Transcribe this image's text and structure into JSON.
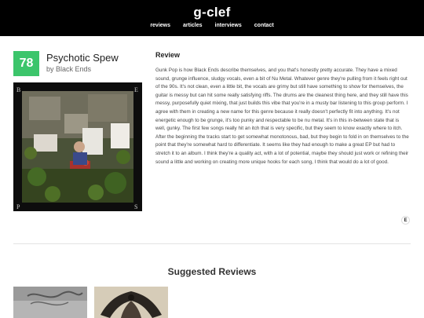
{
  "site": {
    "title": "g-clef",
    "nav": [
      "reviews",
      "articles",
      "interviews",
      "contact"
    ]
  },
  "album": {
    "score": "78",
    "title": "Psychotic Spew",
    "artist": "by Black Ends",
    "cover_letters": [
      "B",
      "E",
      "P",
      "S"
    ]
  },
  "review": {
    "heading": "Review",
    "body": "Gunk Pop is how Black Ends describe themselves, and you that's honestly pretty accurate. They have a mixed sound, grunge influence, sludgy vocals, even a bit of Nu Metal. Whatever genre they're pulling from it feels right out of the 90s. It's not clean, even a little bit, the vocals are grimy but still have something to show for themselves, the guitar is messy but can hit some really satisfying riffs. The drums are the cleanest thing here, and they still have this messy, purposefully quiet mixing, that just builds this vibe that you're in a musty bar listening to this group perform. I agree with them in creating a new name for this genre because it really doesn't perfectly fit into anything. It's not energetic enough to be grunge, it's too punky and respectable to be nu metal. It's in this in-between state that is well, gunky. The first few songs really hit an itch that is very specific, but they seem to know exactly where to itch. After the beginning the tracks start to get somewhat monotonous, bad, but they begin to fold in on themselves to the point that they're somewhat hard to differentiate. It seems like they had enough to make a great EP but had to stretch it to an album. I think they're a quality act, with a lot of potential, maybe they should just work or refining their sound a little and working on creating more unique hooks for each song, I think that would do a lot of good.",
    "rating_letter": "E"
  },
  "suggested": {
    "heading": "Suggested Reviews",
    "thumbs": [
      {
        "icon": "album-cover-thumbnail-gray"
      },
      {
        "icon": "album-cover-thumbnail-symmetric"
      }
    ]
  }
}
